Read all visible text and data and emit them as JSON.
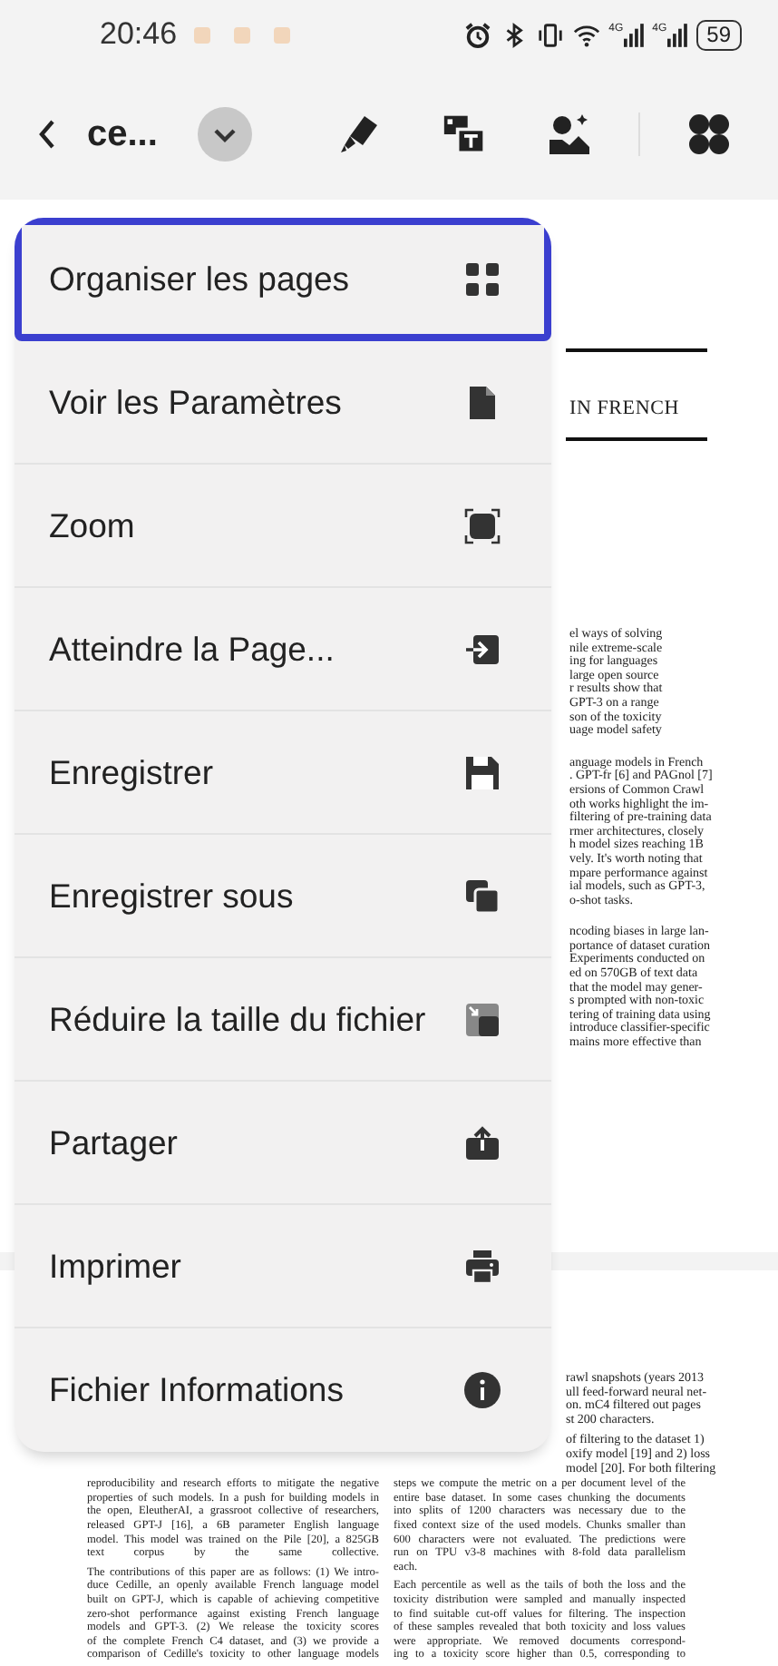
{
  "status_bar": {
    "time": "20:46",
    "network_labels": [
      "4G",
      "4G"
    ],
    "battery": "59"
  },
  "toolbar": {
    "title": "ce..."
  },
  "menu": {
    "items": [
      {
        "label": "Organiser les pages",
        "kind": "grid",
        "selected": true
      },
      {
        "label": "Voir les Paramètres",
        "kind": "document",
        "selected": false
      },
      {
        "label": "Zoom",
        "kind": "zoom",
        "selected": false
      },
      {
        "label": "Atteindre la Page...",
        "kind": "goto",
        "selected": false
      },
      {
        "label": "Enregistrer",
        "kind": "save",
        "selected": false
      },
      {
        "label": "Enregistrer sous",
        "kind": "copy",
        "selected": false
      },
      {
        "label": "Réduire la taille du fichier",
        "kind": "compress",
        "selected": false
      },
      {
        "label": "Partager",
        "kind": "share",
        "selected": false
      },
      {
        "label": "Imprimer",
        "kind": "print",
        "selected": false
      },
      {
        "label": "Fichier Informations",
        "kind": "info",
        "selected": false
      }
    ]
  },
  "document": {
    "page_1": {
      "title": "IN FRENCH",
      "paragraphs": [
        [
          "el ways of solving",
          "nile extreme-scale",
          "ing for languages",
          "large open source",
          "r results show that",
          "GPT-3 on a range",
          "son of the toxicity",
          "uage model safety"
        ],
        [
          "anguage models in French",
          ". GPT-fr [6] and PAGnol [7]",
          "ersions of Common Crawl",
          "oth works highlight the im-",
          "filtering of pre-training data",
          "rmer architectures, closely",
          "h model sizes reaching 1B",
          "vely. It's worth noting that",
          "mpare performance against",
          "ial models, such as GPT-3,",
          "o-shot tasks."
        ],
        [
          "ncoding biases in large lan-",
          "portance of dataset curation",
          "Experiments conducted on",
          "ed on 570GB of text data",
          "that the model may gener-",
          "s prompted with non-toxic",
          "tering of training data using",
          "introduce classifier-specific",
          "mains more effective than"
        ]
      ]
    },
    "page_2": {
      "top_paragraphs": [
        [
          "rawl snapshots (years 2013",
          "ull feed-forward neural net-",
          "on. mC4 filtered out pages",
          "st 200 characters."
        ],
        [
          "of filtering to the dataset 1)",
          "oxify model [19] and 2) loss",
          "model [20]. For both filtering"
        ]
      ],
      "left_column": [
        [
          "reproducibility and research efforts to mitigate the negative",
          "properties of such models. In a push for building models in",
          "the open, EleutherAI, a grassroot collective of researchers,",
          "released GPT-J [16], a 6B parameter English language",
          "model. This model was trained on the Pile [20], a 825GB",
          "text corpus by the same collective."
        ],
        [
          "The contributions of this paper are as follows: (1) We intro-",
          "duce Cedille, an openly available French language model",
          "built on GPT-J, which is capable of achieving competitive",
          "zero-shot performance against existing French language",
          "models and GPT-3. (2) We release the toxicity scores",
          "of the complete French C4 dataset, and (3) we provide a",
          "comparison of Cedille's toxicity to other language models"
        ]
      ],
      "right_column": [
        [
          "steps we compute the metric on a per document level of the",
          "entire base dataset. In some cases chunking the documents",
          "into splits of 1200 characters was necessary due to the",
          "fixed context size of the used models. Chunks smaller than",
          "600 characters were not evaluated. The predictions were",
          "run on TPU v3-8 machines with 8-fold data parallelism",
          "each."
        ],
        [
          "Each percentile as well as the tails of both the loss and the",
          "toxicity distribution were sampled and manually inspected",
          "to find suitable cut-off values for filtering. The inspection",
          "of these samples revealed that both toxicity and loss values",
          "were appropriate. We removed documents correspond-",
          "ing to a toxicity score higher than 0.5, corresponding to"
        ]
      ]
    }
  }
}
